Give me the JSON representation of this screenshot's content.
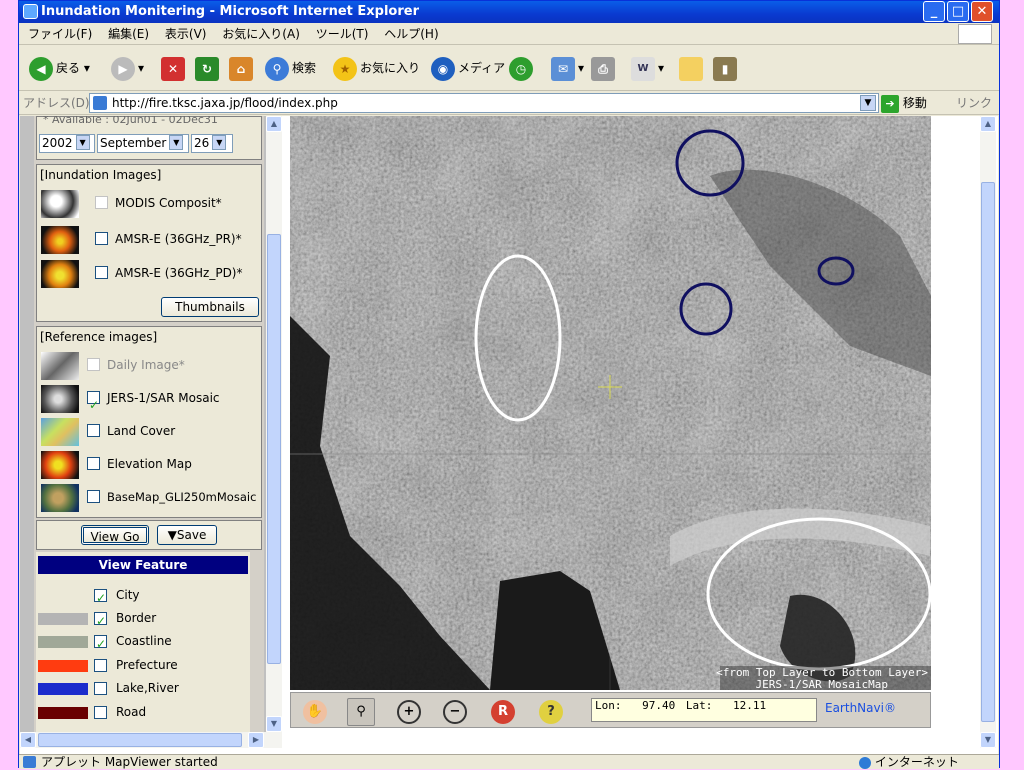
{
  "window": {
    "title": "Inundation Monitering - Microsoft Internet Explorer"
  },
  "menu": [
    "ファイル(F)",
    "編集(E)",
    "表示(V)",
    "お気に入り(A)",
    "ツール(T)",
    "ヘルプ(H)"
  ],
  "toolbar": {
    "back": "戻る",
    "search": "検索",
    "favorites": "お気に入り",
    "media": "メディア"
  },
  "address": {
    "label": "アドレス(D)",
    "url": "http://fire.tksc.jaxa.jp/flood/index.php",
    "go": "移動",
    "links": "リンク"
  },
  "date_panel": {
    "available": "* Available : 02Jun01 - 02Dec31",
    "year": "2002",
    "month": "September",
    "day": "26"
  },
  "inundation": {
    "header": "[Inundation Images]",
    "items": [
      {
        "label": "MODIS Composit*",
        "checked": false,
        "disabled": true
      },
      {
        "label": "AMSR-E (36GHz_PR)*",
        "checked": false,
        "disabled": false
      },
      {
        "label": "AMSR-E (36GHz_PD)*",
        "checked": false,
        "disabled": false
      }
    ],
    "thumbnails_button": "Thumbnails"
  },
  "reference": {
    "header": "[Reference images]",
    "items": [
      {
        "label": "Daily Image*",
        "checked": false,
        "disabled": true
      },
      {
        "label": "JERS-1/SAR Mosaic",
        "checked": true,
        "disabled": false
      },
      {
        "label": "Land Cover",
        "checked": false,
        "disabled": false
      },
      {
        "label": "Elevation Map",
        "checked": false,
        "disabled": false
      },
      {
        "label": "BaseMap_GLI250mMosaic",
        "checked": false,
        "disabled": false
      }
    ]
  },
  "actions": {
    "view_go": "View Go",
    "save": "▼Save"
  },
  "view_feature": {
    "title": "View Feature",
    "items": [
      {
        "label": "City",
        "checked": true,
        "color": ""
      },
      {
        "label": "Border",
        "checked": true,
        "color": "#b4b4b4"
      },
      {
        "label": "Coastline",
        "checked": true,
        "color": "#a0a898"
      },
      {
        "label": "Prefecture",
        "checked": false,
        "color": "#ff3c10"
      },
      {
        "label": "Lake,River",
        "checked": false,
        "color": "#1c2ccc"
      },
      {
        "label": "Road",
        "checked": false,
        "color": "#6a0000"
      }
    ]
  },
  "map": {
    "layer_caption_1": "<from Top Layer to Bottom Layer>",
    "layer_caption_2": "JERS-1/SAR MosaicMap",
    "coord_lon_label": "Lon:",
    "coord_lon": "97.40",
    "coord_lat_label": "Lat:",
    "coord_lat": "12.11",
    "earthnavi": "EarthNavi®"
  },
  "status": {
    "text": "アプレット MapViewer started",
    "zone": "インターネット"
  }
}
